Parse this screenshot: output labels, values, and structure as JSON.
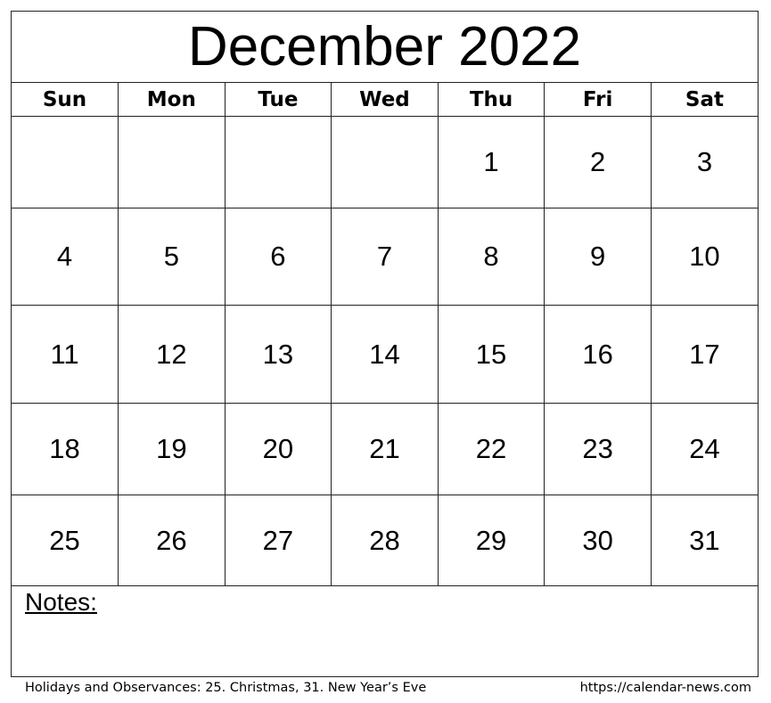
{
  "title": "December 2022",
  "weekdays": [
    "Sun",
    "Mon",
    "Tue",
    "Wed",
    "Thu",
    "Fri",
    "Sat"
  ],
  "weeks": [
    [
      "",
      "",
      "",
      "",
      "1",
      "2",
      "3"
    ],
    [
      "4",
      "5",
      "6",
      "7",
      "8",
      "9",
      "10"
    ],
    [
      "11",
      "12",
      "13",
      "14",
      "15",
      "16",
      "17"
    ],
    [
      "18",
      "19",
      "20",
      "21",
      "22",
      "23",
      "24"
    ],
    [
      "25",
      "26",
      "27",
      "28",
      "29",
      "30",
      "31"
    ]
  ],
  "notes_label": "Notes:",
  "footer": {
    "holidays": "Holidays and Observances: 25. Christmas, 31. New Year’s Eve",
    "url": "https://calendar-news.com"
  }
}
